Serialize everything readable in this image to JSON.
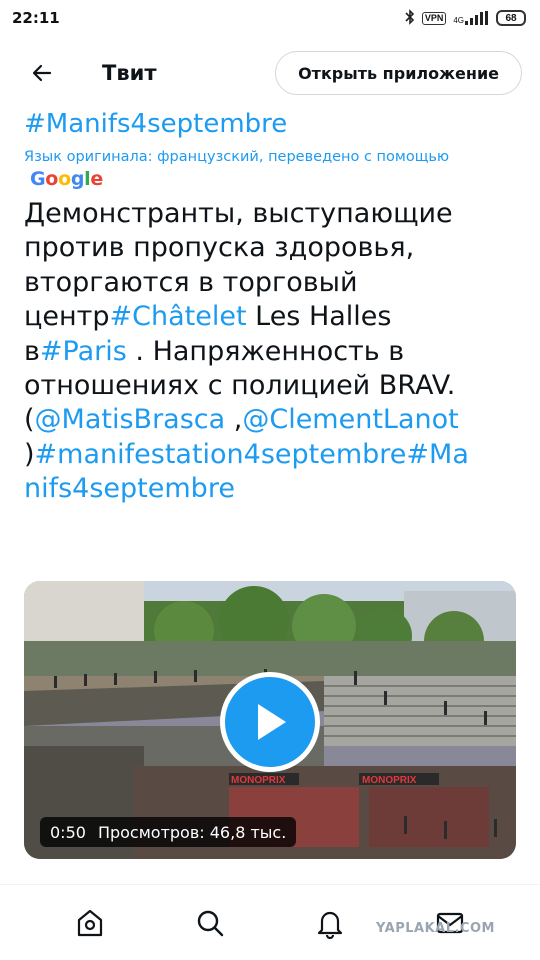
{
  "status_bar": {
    "time": "22:11",
    "vpn": "VPN",
    "network": "4G",
    "battery": "68"
  },
  "header": {
    "title": "Твит",
    "open_app_label": "Открыть приложение"
  },
  "tweet": {
    "top_hashtag": "#Manifs4septembre",
    "translation_note": "Язык оригинала: французский, переведено с помощью",
    "google": [
      "G",
      "o",
      "o",
      "g",
      "l",
      "e"
    ],
    "google_colors": [
      "#4285F4",
      "#EA4335",
      "#FBBC05",
      "#4285F4",
      "#34A853",
      "#EA4335"
    ],
    "body": {
      "line1": "Демонстранты, выступающие",
      "line2": "против пропуска здоровья,",
      "line3": "вторгаются в торговый",
      "line4_text": "центр",
      "line4_link": "#Châtelet",
      "line4_rest": " Les Halles",
      "line5_text": "в",
      "line5_link": "#Paris",
      "line5_rest": " . Напряженность в",
      "line6": "отношениях с полицией BRAV.",
      "line7_open": "(",
      "mention1": "@MatisBrasca",
      "line7_sep": " ,",
      "mention2": "@ClementLanot",
      "line8_close": ")",
      "line8_link": "#manifestation4septembre#Ma",
      "line9_link": "nifs4septembre"
    },
    "link_color": "#1d9bf0"
  },
  "video": {
    "duration": "0:50",
    "views": "Просмотров: 46,8 тыс.",
    "store_sign_1": "MONOPRIX",
    "store_sign_2": "MONOPRIX"
  },
  "bottom_nav": {
    "items": [
      "home-icon",
      "search-icon",
      "notifications-icon",
      "messages-icon"
    ]
  },
  "watermark": "YAPLAKAL.COM"
}
